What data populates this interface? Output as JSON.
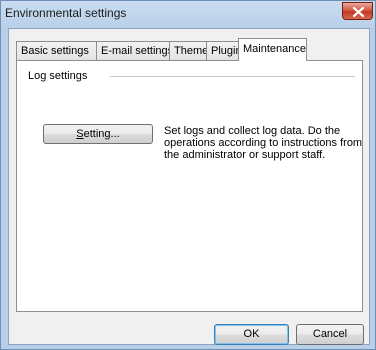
{
  "window": {
    "title": "Environmental settings"
  },
  "tabs": [
    {
      "label": "Basic settings"
    },
    {
      "label": "E-mail settings"
    },
    {
      "label": "Theme"
    },
    {
      "label": "Plugin"
    },
    {
      "label": "Maintenance",
      "active": true
    }
  ],
  "log_settings": {
    "group_label": "Log settings",
    "setting_button_mnemonic": "S",
    "setting_button_rest": "etting...",
    "description": "Set logs and collect log data. Do the operations according to instructions from the administrator or support staff."
  },
  "footer": {
    "ok_label": "OK",
    "cancel_label": "Cancel"
  },
  "icons": {
    "close": "close-icon"
  }
}
